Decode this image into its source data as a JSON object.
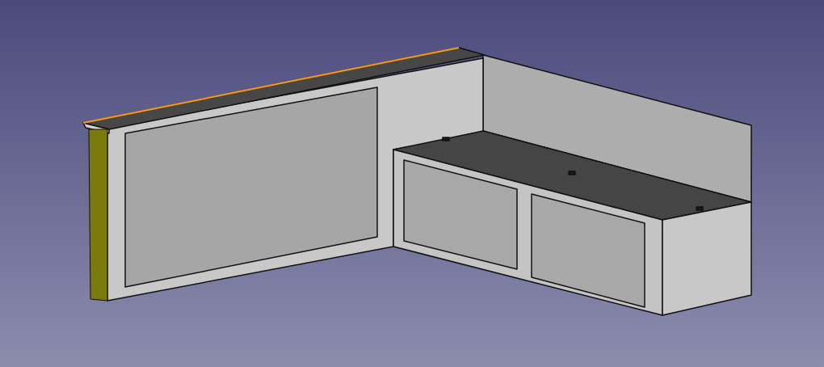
{
  "viewport": {
    "top_edge": {
      "selected": true
    },
    "end_face": {
      "selected": true
    }
  }
}
